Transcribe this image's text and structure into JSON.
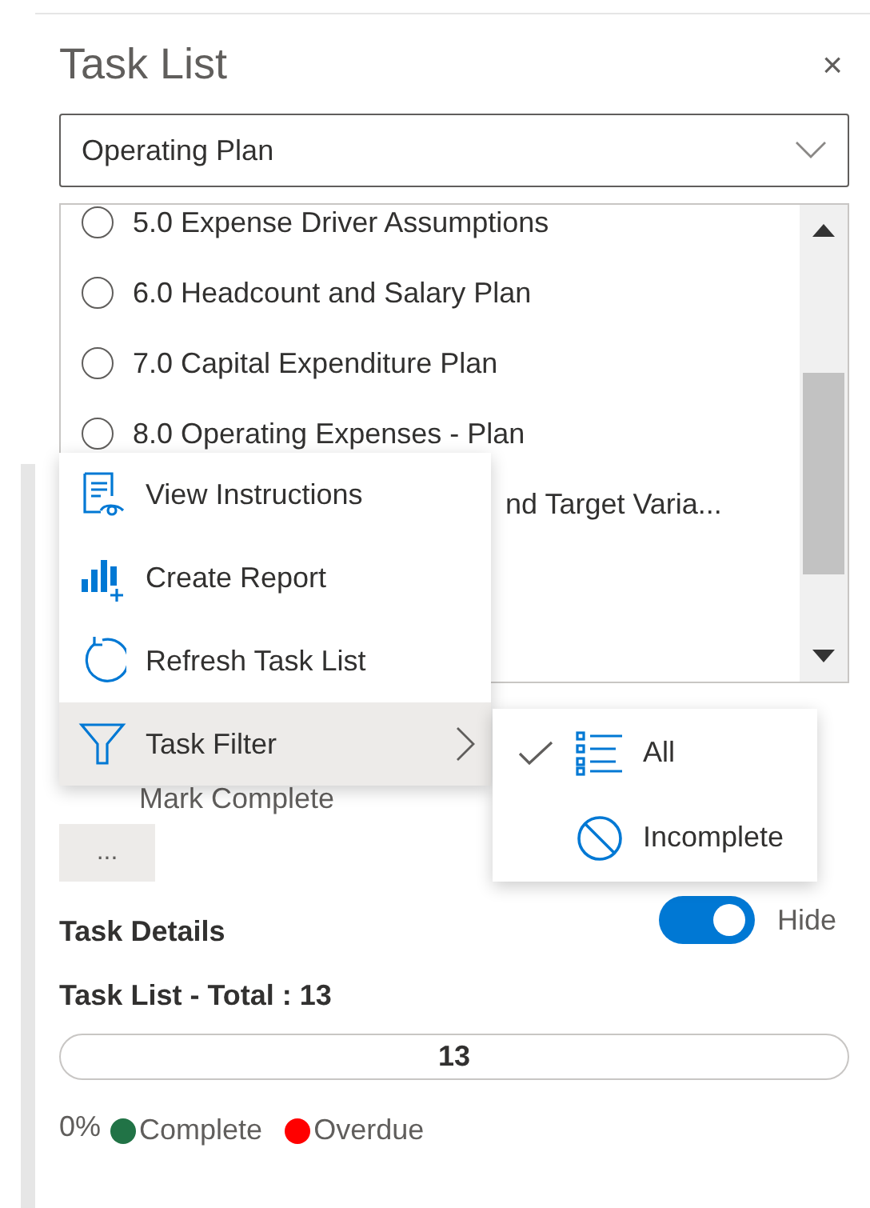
{
  "panel": {
    "title": "Task List",
    "close": "×"
  },
  "plan_select": {
    "value": "Operating Plan"
  },
  "tasks": [
    {
      "kind": "task",
      "label": "5.0 Expense Driver Assumptions",
      "checked": false
    },
    {
      "kind": "task",
      "label": "6.0 Headcount and Salary Plan",
      "checked": false
    },
    {
      "kind": "task",
      "label": "7.0 Capital Expenditure Plan",
      "checked": false
    },
    {
      "kind": "task",
      "label": "8.0 Operating Expenses - Plan",
      "checked": false
    },
    {
      "kind": "covered",
      "label": "nd Target Varia..."
    }
  ],
  "mark_complete": {
    "label": "Mark Complete"
  },
  "more_button": {
    "label": "..."
  },
  "context_menu": [
    {
      "kind": "instructions",
      "label": "View Instructions",
      "selected": false,
      "submenu": false
    },
    {
      "kind": "report",
      "label": "Create Report",
      "selected": false,
      "submenu": false
    },
    {
      "kind": "refresh",
      "label": "Refresh Task List",
      "selected": false,
      "submenu": false
    },
    {
      "kind": "filter",
      "label": "Task Filter",
      "selected": true,
      "submenu": true
    }
  ],
  "filter_submenu": [
    {
      "kind": "all",
      "label": "All",
      "checked": true
    },
    {
      "kind": "incomplete",
      "label": "Incomplete",
      "checked": false
    }
  ],
  "task_details": {
    "label": "Task Details",
    "toggle_on": true,
    "toggle_label": "Hide"
  },
  "summary": {
    "title": "Task List - Total : 13",
    "bar_text": "13",
    "level": 0,
    "percent": "0%"
  },
  "legend": [
    {
      "label": "Complete",
      "color": "#217346"
    },
    {
      "label": "Overdue",
      "color": "#ff0000"
    }
  ]
}
